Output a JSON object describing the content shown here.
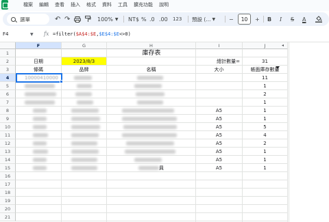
{
  "menu": [
    "檔案",
    "編輯",
    "查看",
    "插入",
    "格式",
    "資料",
    "工具",
    "擴充功能",
    "說明"
  ],
  "toolbar": {
    "search_label": "選單",
    "zoom": "100%",
    "currency": "NT$",
    "percent": "%",
    "dec_decrease": ".0",
    "dec_increase": ".00",
    "number_format": "123",
    "font_name": "預設 (...",
    "font_size": "10",
    "minus": "−",
    "plus": "+",
    "bold": "B",
    "italic": "I",
    "strike": "S",
    "text_color": "A"
  },
  "formula_bar": {
    "cell_ref": "F4",
    "fx": "fx",
    "formula_prefix": "=filter(",
    "range1": "$A$4:$E",
    "sep1": ",",
    "range2": "$E$4:$E",
    "suffix": "<>0)"
  },
  "columns": [
    "F",
    "G",
    "H",
    "I",
    "J"
  ],
  "rows": [
    "1",
    "2",
    "3",
    "4",
    "5",
    "6",
    "7",
    "8",
    "9",
    "10",
    "11",
    "12",
    "13",
    "14",
    "15",
    "16",
    "17",
    "18",
    "19",
    "20",
    "21"
  ],
  "sheet": {
    "title": "庫存表",
    "date_label": "日期",
    "date_value": "2023/8/3",
    "total_label": "總計數量=",
    "total_value": "31",
    "headers": {
      "barcode": "條碼",
      "brand": "品牌",
      "name": "名稱",
      "size": "大小",
      "qty": "帳面庫存數量"
    },
    "barcode_partial": "10000410000",
    "sizes": [
      "",
      "",
      "",
      "",
      "A5",
      "A5",
      "A5",
      "A5",
      "A5",
      "A5",
      "A5",
      "A5"
    ],
    "quantities": [
      "11",
      "1",
      "2",
      "1",
      "1",
      "1",
      "5",
      "4",
      "2",
      "1",
      "1",
      "1"
    ],
    "name_suffix_row15": "員"
  },
  "colors": {
    "accent": "#1a73e8",
    "highlight": "#ffff00",
    "sheets_green": "#0f9d58"
  }
}
